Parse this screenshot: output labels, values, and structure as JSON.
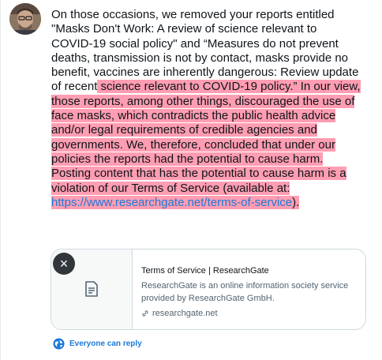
{
  "tweet": {
    "text_plain": "On those occasions, we removed your reports entitled \"Masks Don't Work: A review of science relevant to COVID-19 social policy\" and “Measures do not prevent deaths, transmission is not by contact, masks provide no benefit, vaccines are inherently dangerous: Review update of recent",
    "text_highlighted": " science relevant to COVID-19 policy.” In our view, those reports, among other things, discouraged the use of face masks, which contradicts the public health advice and/or legal requirements of credible agencies and governments. We, therefore, concluded that under our policies the reports had the potential to cause harm. Posting content that has the potential to cause harm is a violation of our Terms of Service (available at: ",
    "link_text": "https://www.researchgate.net/terms-of-service",
    "text_end": ")."
  },
  "card": {
    "close_glyph": "×",
    "title": "Terms of Service | ResearchGate",
    "description": "ResearchGate is an online information society service provided by ResearchGate GmbH.",
    "domain": "researchgate.net"
  },
  "reply": {
    "label": "Everyone can reply"
  },
  "colors": {
    "highlight": "#ff9db2",
    "link": "#1b7ad8"
  }
}
